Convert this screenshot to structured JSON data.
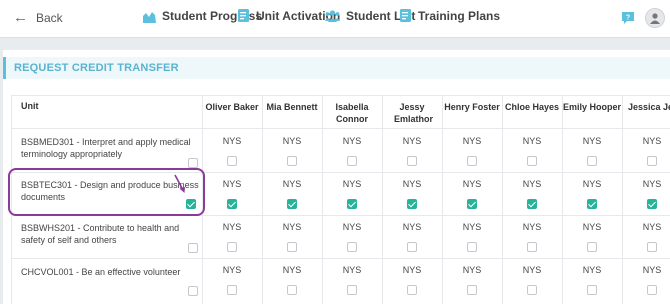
{
  "header": {
    "back_label": "Back",
    "nav": [
      {
        "label": "Student Progress",
        "icon": "chart-icon"
      },
      {
        "label": "Unit Activation",
        "icon": "document-icon"
      },
      {
        "label": "Student List",
        "icon": "users-icon"
      },
      {
        "label": "Training Plans",
        "icon": "document-icon"
      }
    ],
    "accent_color": "#5bc0de"
  },
  "section": {
    "title": "REQUEST CREDIT TRANSFER"
  },
  "table": {
    "unit_header": "Unit",
    "students": [
      "Oliver Baker",
      "Mia Bennett",
      "Isabella Connor",
      "Jessy Emlathor",
      "Henry Foster",
      "Chloe Hayes",
      "Emily Hooper",
      "Jessica Jet"
    ],
    "rows": [
      {
        "unit": "BSBMED301 - Interpret and apply medical terminology appropriately",
        "row_checked": false,
        "statuses": [
          "NYS",
          "NYS",
          "NYS",
          "NYS",
          "NYS",
          "NYS",
          "NYS",
          "NYS"
        ],
        "checked": [
          false,
          false,
          false,
          false,
          false,
          false,
          false,
          false
        ]
      },
      {
        "unit": "BSBTEC301 - Design and produce business documents",
        "row_checked": true,
        "statuses": [
          "NYS",
          "NYS",
          "NYS",
          "NYS",
          "NYS",
          "NYS",
          "NYS",
          "NYS"
        ],
        "checked": [
          true,
          true,
          true,
          true,
          true,
          true,
          true,
          true
        ]
      },
      {
        "unit": "BSBWHS201 - Contribute to health and safety of self and others",
        "row_checked": false,
        "statuses": [
          "NYS",
          "NYS",
          "NYS",
          "NYS",
          "NYS",
          "NYS",
          "NYS",
          "NYS"
        ],
        "checked": [
          false,
          false,
          false,
          false,
          false,
          false,
          false,
          false
        ]
      },
      {
        "unit": "CHCVOL001 - Be an effective volunteer",
        "row_checked": false,
        "statuses": [
          "NYS",
          "NYS",
          "NYS",
          "NYS",
          "NYS",
          "NYS",
          "NYS",
          "NYS"
        ],
        "checked": [
          false,
          false,
          false,
          false,
          false,
          false,
          false,
          false
        ]
      }
    ],
    "checked_color": "#26b39a",
    "highlight_color": "#8a3b9a"
  }
}
